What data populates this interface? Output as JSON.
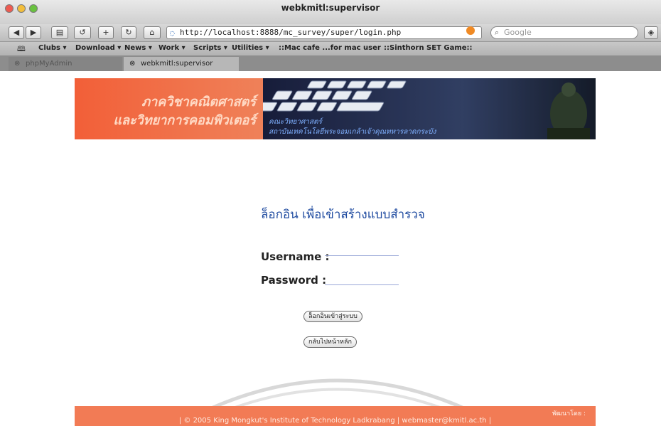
{
  "window": {
    "title": "webkmitl:supervisor"
  },
  "toolbar": {
    "address": "http://localhost:8888/mc_survey/super/login.php",
    "search_placeholder": "Google"
  },
  "bookmarks": [
    "Clubs ▾",
    "Download ▾",
    "News ▾",
    "Work ▾",
    "Scripts ▾",
    "Utilities ▾",
    "::Mac cafe ...for mac user",
    "::Sinthorn SET Game::"
  ],
  "tabs": [
    {
      "label": "phpMyAdmin",
      "active": false
    },
    {
      "label": "webkmitl:supervisor",
      "active": true
    }
  ],
  "page": {
    "banner_line1": "ภาควิชาคณิตศาสตร์",
    "banner_line2": "และวิทยาการคอมพิวเตอร์",
    "banner_sub1": "คณะวิทยาศาสตร์",
    "banner_sub2": "สถาบันเทคโนโลยีพระจอมเกล้าเจ้าคุณทหารลาดกระบัง",
    "login_title": "ล็อกอิน เพื่อเข้าสร้างแบบสำรวจ",
    "username_label": "Username :",
    "password_label": "Password :",
    "login_button": "ล็อกอินเข้าสู่ระบบ",
    "home_button": "กลับไปหน้าหลัก",
    "footer_right": "พัฒนาโดย :",
    "footer_copy": "| © 2005 King Mongkut's Institute of Technology Ladkrabang | webmaster@kmitl.ac.th |"
  },
  "colors": {
    "accent_orange": "#f27b55",
    "title_blue": "#1f4ba0"
  }
}
